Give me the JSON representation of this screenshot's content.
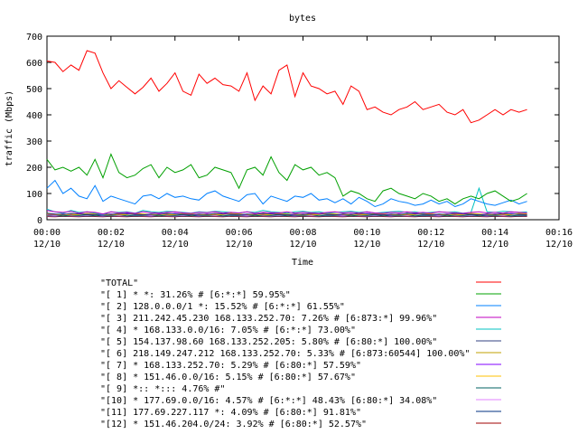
{
  "chart_data": {
    "type": "line",
    "title": "bytes",
    "xlabel": "Time",
    "ylabel": "traffic (Mbps)",
    "ylim": [
      0,
      700
    ],
    "yticks": [
      0,
      100,
      200,
      300,
      400,
      500,
      600,
      700
    ],
    "xlim_minutes": [
      0,
      16
    ],
    "xticks": [
      {
        "t": 0,
        "time": "00:00",
        "date": "12/10"
      },
      {
        "t": 2,
        "time": "00:02",
        "date": "12/10"
      },
      {
        "t": 4,
        "time": "00:04",
        "date": "12/10"
      },
      {
        "t": 6,
        "time": "00:06",
        "date": "12/10"
      },
      {
        "t": 8,
        "time": "00:08",
        "date": "12/10"
      },
      {
        "t": 10,
        "time": "00:10",
        "date": "12/10"
      },
      {
        "t": 12,
        "time": "00:12",
        "date": "12/10"
      },
      {
        "t": 14,
        "time": "00:14",
        "date": "12/10"
      },
      {
        "t": 16,
        "time": "00:16",
        "date": "12/10"
      }
    ],
    "grid": false,
    "legend_position": "bottom",
    "x_minutes": [
      0,
      0.25,
      0.5,
      0.75,
      1,
      1.25,
      1.5,
      1.75,
      2,
      2.25,
      2.5,
      2.75,
      3,
      3.25,
      3.5,
      3.75,
      4,
      4.25,
      4.5,
      4.75,
      5,
      5.25,
      5.5,
      5.75,
      6,
      6.25,
      6.5,
      6.75,
      7,
      7.25,
      7.5,
      7.75,
      8,
      8.25,
      8.5,
      8.75,
      9,
      9.25,
      9.5,
      9.75,
      10,
      10.25,
      10.5,
      10.75,
      11,
      11.25,
      11.5,
      11.75,
      12,
      12.25,
      12.5,
      12.75,
      13,
      13.25,
      13.5,
      13.75,
      14,
      14.25,
      14.5,
      14.75,
      15
    ],
    "series": [
      {
        "name": "\"TOTAL\"",
        "color": "#ff0000",
        "values": [
          605,
          600,
          565,
          590,
          570,
          645,
          635,
          560,
          500,
          530,
          505,
          480,
          505,
          540,
          490,
          520,
          560,
          490,
          475,
          555,
          520,
          540,
          515,
          510,
          490,
          560,
          455,
          510,
          480,
          570,
          590,
          470,
          560,
          510,
          500,
          480,
          490,
          440,
          510,
          490,
          420,
          430,
          410,
          400,
          420,
          430,
          450,
          420,
          430,
          440,
          410,
          400,
          420,
          370,
          380,
          400,
          420,
          400,
          420,
          410,
          420
        ]
      },
      {
        "name": "\"[ 1] * *: 31.26% # [6:*:*] 59.95%\"",
        "color": "#00a000",
        "values": [
          230,
          190,
          200,
          185,
          200,
          170,
          230,
          160,
          250,
          180,
          160,
          170,
          195,
          210,
          160,
          200,
          180,
          190,
          210,
          160,
          170,
          200,
          190,
          180,
          120,
          190,
          200,
          170,
          240,
          180,
          150,
          210,
          190,
          200,
          170,
          180,
          160,
          90,
          110,
          100,
          80,
          70,
          110,
          120,
          100,
          90,
          80,
          100,
          90,
          70,
          80,
          60,
          80,
          90,
          80,
          100,
          110,
          90,
          70,
          80,
          100
        ]
      },
      {
        "name": "\"[ 2] 128.0.0.0/1 *: 15.52% # [6:*:*] 61.55%\"",
        "color": "#0080ff",
        "values": [
          120,
          150,
          100,
          120,
          90,
          80,
          130,
          70,
          90,
          80,
          70,
          60,
          90,
          95,
          80,
          100,
          85,
          90,
          80,
          75,
          100,
          110,
          90,
          80,
          70,
          95,
          100,
          60,
          90,
          80,
          70,
          90,
          85,
          100,
          75,
          80,
          65,
          80,
          60,
          85,
          70,
          50,
          60,
          80,
          70,
          65,
          55,
          60,
          75,
          60,
          70,
          50,
          60,
          80,
          70,
          60,
          55,
          65,
          75,
          60,
          70
        ]
      },
      {
        "name": "\"[ 3] 211.242.45.230 168.133.252.70: 7.26% # [6:873:*] 99.96%\"",
        "color": "#c000c0",
        "values": [
          35,
          30,
          28,
          32,
          25,
          30,
          28,
          22,
          30,
          26,
          28,
          24,
          30,
          27,
          25,
          28,
          30,
          26,
          24,
          28,
          27,
          30,
          25,
          28,
          26,
          30,
          24,
          28,
          27,
          26,
          30,
          25,
          28,
          26,
          24,
          28,
          30,
          26,
          28,
          25,
          30,
          26,
          24,
          28,
          27,
          30,
          26,
          28,
          25,
          30,
          28,
          26,
          24,
          28,
          30,
          26,
          28,
          25,
          30,
          28,
          26
        ]
      },
      {
        "name": "\"[ 4] * 168.133.0.0/16: 7.05% # [6:*:*] 73.00%\"",
        "color": "#00c0c0",
        "values": [
          40,
          30,
          25,
          35,
          28,
          30,
          25,
          20,
          30,
          28,
          30,
          25,
          35,
          30,
          28,
          32,
          30,
          28,
          25,
          30,
          28,
          32,
          30,
          28,
          25,
          30,
          28,
          35,
          30,
          28,
          25,
          30,
          32,
          28,
          30,
          25,
          28,
          30,
          32,
          28,
          30,
          25,
          28,
          30,
          32,
          28,
          30,
          25,
          28,
          30,
          28,
          30,
          25,
          28,
          120,
          30,
          28,
          32,
          30,
          28,
          30
        ]
      },
      {
        "name": "\"[ 5] 154.137.98.60 168.133.252.205: 5.80% # [6:80:*] 100.00%\"",
        "color": "#304080",
        "values": [
          25,
          22,
          20,
          24,
          22,
          20,
          18,
          22,
          20,
          24,
          22,
          20,
          18,
          22,
          20,
          24,
          22,
          20,
          18,
          22,
          20,
          24,
          22,
          20,
          18,
          22,
          20,
          24,
          22,
          20,
          18,
          22,
          20,
          24,
          22,
          20,
          18,
          22,
          20,
          24,
          22,
          20,
          18,
          22,
          20,
          24,
          22,
          20,
          18,
          22,
          20,
          24,
          22,
          20,
          18,
          22,
          20,
          24,
          22,
          20,
          18
        ]
      },
      {
        "name": "\"[ 6] 218.149.247.212 168.133.252.70: 5.33% # [6:873:60544] 100.00%\"",
        "color": "#c0a000",
        "values": [
          22,
          20,
          18,
          22,
          20,
          24,
          22,
          20,
          18,
          22,
          20,
          24,
          22,
          20,
          18,
          22,
          20,
          24,
          22,
          20,
          18,
          22,
          20,
          24,
          22,
          20,
          18,
          22,
          20,
          24,
          22,
          20,
          18,
          22,
          20,
          24,
          22,
          20,
          18,
          22,
          20,
          24,
          22,
          20,
          18,
          22,
          20,
          24,
          22,
          20,
          18,
          22,
          20,
          24,
          22,
          20,
          18,
          22,
          20,
          24,
          22
        ]
      },
      {
        "name": "\"[ 7] * 168.133.252.70: 5.29% # [6:80:*] 57.59%\"",
        "color": "#8000ff",
        "values": [
          20,
          18,
          22,
          20,
          24,
          22,
          20,
          18,
          22,
          20,
          24,
          22,
          20,
          18,
          22,
          20,
          24,
          22,
          20,
          18,
          22,
          20,
          24,
          22,
          20,
          18,
          22,
          20,
          24,
          22,
          20,
          18,
          22,
          20,
          24,
          22,
          20,
          18,
          22,
          20,
          24,
          22,
          20,
          18,
          22,
          20,
          24,
          22,
          20,
          18,
          22,
          20,
          24,
          22,
          20,
          18,
          22,
          20,
          24,
          22,
          20
        ]
      },
      {
        "name": "\"[ 8] * 151.46.0.0/16: 5.15% # [6:80:*] 57.67%\"",
        "color": "#ffc000",
        "values": [
          18,
          20,
          22,
          18,
          20,
          22,
          18,
          20,
          22,
          18,
          20,
          22,
          18,
          20,
          22,
          18,
          20,
          22,
          18,
          20,
          22,
          18,
          20,
          22,
          18,
          20,
          22,
          18,
          20,
          22,
          18,
          20,
          22,
          18,
          20,
          22,
          18,
          20,
          22,
          18,
          20,
          22,
          18,
          20,
          22,
          18,
          20,
          22,
          18,
          20,
          22,
          18,
          20,
          22,
          18,
          20,
          22,
          18,
          20,
          22,
          18
        ]
      },
      {
        "name": "\"[ 9] *:: *::: 4.76% #\"",
        "color": "#006060",
        "values": [
          16,
          18,
          15,
          17,
          16,
          18,
          15,
          17,
          16,
          18,
          15,
          17,
          16,
          18,
          15,
          17,
          16,
          18,
          15,
          17,
          16,
          18,
          15,
          17,
          16,
          18,
          15,
          17,
          16,
          18,
          15,
          17,
          16,
          18,
          15,
          17,
          16,
          18,
          15,
          17,
          16,
          18,
          15,
          17,
          16,
          18,
          15,
          17,
          16,
          18,
          15,
          17,
          16,
          18,
          15,
          17,
          16,
          18,
          15,
          17,
          16
        ]
      },
      {
        "name": "\"[10] * 177.69.0.0/16: 4.57% # [6:*:*] 48.43% [6:80:*] 34.08%\"",
        "color": "#e080ff",
        "values": [
          15,
          14,
          16,
          15,
          14,
          16,
          15,
          14,
          16,
          15,
          14,
          16,
          15,
          14,
          16,
          15,
          14,
          16,
          15,
          14,
          16,
          15,
          14,
          16,
          15,
          14,
          16,
          15,
          14,
          16,
          15,
          14,
          16,
          15,
          14,
          16,
          15,
          14,
          16,
          15,
          14,
          16,
          15,
          14,
          16,
          15,
          14,
          16,
          15,
          14,
          16,
          15,
          14,
          16,
          15,
          14,
          16,
          15,
          14,
          16,
          15
        ]
      },
      {
        "name": "\"[11] 177.69.227.117 *: 4.09% # [6:80:*] 91.81%\"",
        "color": "#003080",
        "values": [
          14,
          13,
          15,
          14,
          13,
          15,
          14,
          13,
          15,
          14,
          13,
          15,
          14,
          13,
          15,
          14,
          13,
          15,
          14,
          13,
          15,
          14,
          13,
          15,
          14,
          13,
          15,
          14,
          13,
          15,
          14,
          13,
          15,
          14,
          13,
          15,
          14,
          13,
          15,
          14,
          13,
          15,
          14,
          13,
          15,
          14,
          13,
          15,
          14,
          13,
          15,
          14,
          13,
          15,
          14,
          13,
          15,
          14,
          13,
          15,
          14
        ]
      },
      {
        "name": "\"[12] * 151.46.204.0/24: 3.92% # [6:80:*] 52.57%\"",
        "color": "#a00000",
        "values": [
          12,
          11,
          13,
          12,
          11,
          13,
          12,
          11,
          13,
          12,
          11,
          13,
          12,
          11,
          13,
          12,
          11,
          13,
          12,
          11,
          13,
          12,
          11,
          13,
          12,
          11,
          13,
          12,
          11,
          13,
          12,
          11,
          13,
          12,
          11,
          13,
          12,
          11,
          13,
          12,
          11,
          13,
          12,
          11,
          13,
          12,
          11,
          13,
          12,
          11,
          13,
          12,
          11,
          13,
          12,
          11,
          13,
          12,
          11,
          13,
          12
        ]
      }
    ]
  }
}
